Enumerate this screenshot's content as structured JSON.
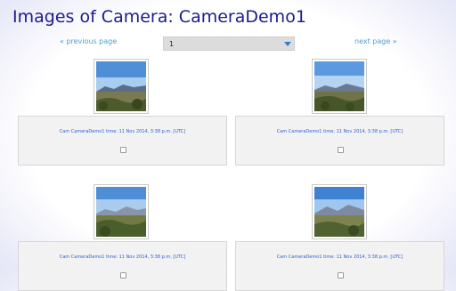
{
  "header": {
    "title": "Images of Camera: CameraDemo1"
  },
  "pagination": {
    "previous_label": "« previous page",
    "next_label": "next page »",
    "selected_page": "1"
  },
  "images": [
    {
      "caption": "Cam CameraDemo1 time: 11 Nov 2014, 3:38 p.m. [UTC]",
      "selected": false
    },
    {
      "caption": "Cam CameraDemo1 time: 11 Nov 2014, 3:38 p.m. [UTC]",
      "selected": false
    },
    {
      "caption": "Cam CameraDemo1 time: 11 Nov 2014, 3:38 p.m. [UTC]",
      "selected": false
    },
    {
      "caption": "Cam CameraDemo1 time: 11 Nov 2014, 3:38 p.m. [UTC]",
      "selected": false
    }
  ],
  "colors": {
    "title": "#1c1c8c",
    "link": "#4a9fd0",
    "caption": "#2d5fd0",
    "accent": "#2f7fc7"
  }
}
